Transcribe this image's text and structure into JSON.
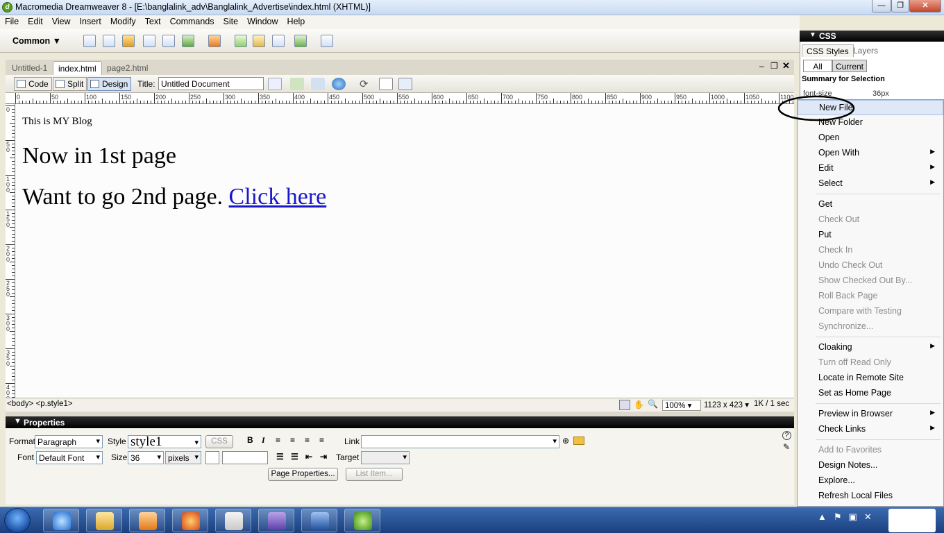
{
  "window": {
    "title": "Macromedia Dreamweaver 8 - [E:\\banglalink_adv\\Banglalink_Advertise\\index.html (XHTML)]",
    "minimize": "—",
    "maximize": "❐",
    "close": "✕"
  },
  "menu": [
    "File",
    "Edit",
    "View",
    "Insert",
    "Modify",
    "Text",
    "Commands",
    "Site",
    "Window",
    "Help"
  ],
  "insert_bar": {
    "category": "Common"
  },
  "doc_tabs": [
    "Untitled-1",
    "index.html",
    "page2.html"
  ],
  "doc_toolbar": {
    "code": "Code",
    "split": "Split",
    "design": "Design",
    "title_label": "Title:",
    "title_value": "Untitled Document"
  },
  "ruler": {
    "h_marks": [
      "0",
      "50",
      "100",
      "150",
      "200",
      "250",
      "300",
      "350",
      "400",
      "450",
      "500",
      "550",
      "600",
      "650",
      "700",
      "750",
      "800",
      "850",
      "900",
      "950",
      "1000",
      "1050",
      "1100"
    ],
    "v_marks": [
      "0",
      "50",
      "100",
      "150",
      "200",
      "250",
      "300",
      "350",
      "400"
    ]
  },
  "design_view": {
    "line1": "This is MY Blog",
    "line2": "Now in 1st page",
    "line3": "Want to go 2nd page.",
    "link": "Click here"
  },
  "status_bar": {
    "tags": "<body> <p.style1>",
    "zoom": "100%",
    "window_size": "1123 x 423",
    "download": "1K / 1 sec"
  },
  "properties": {
    "header": "Properties",
    "format_label": "Format",
    "format_value": "Paragraph",
    "style_label": "Style",
    "style_value": "style1",
    "css_button": "CSS",
    "link_label": "Link",
    "font_label": "Font",
    "font_value": "Default Font",
    "size_label": "Size",
    "size_value": "36",
    "unit_value": "pixels",
    "target_label": "Target",
    "page_properties": "Page Properties...",
    "list_item": "List Item...",
    "bold": "B",
    "italic": "I"
  },
  "css_panel": {
    "header": "CSS",
    "tabs": [
      "CSS Styles",
      "Layers"
    ],
    "modes": [
      "All",
      "Current"
    ],
    "summary": "Summary for Selection",
    "prop_name": "font-size",
    "prop_value": "36px"
  },
  "context_menu": [
    {
      "label": "New File",
      "enabled": true,
      "submenu": false,
      "highlight": true
    },
    {
      "label": "New Folder",
      "enabled": true,
      "submenu": false
    },
    {
      "label": "Open",
      "enabled": true,
      "submenu": false
    },
    {
      "label": "Open With",
      "enabled": true,
      "submenu": true
    },
    {
      "label": "Edit",
      "enabled": true,
      "submenu": true
    },
    {
      "label": "Select",
      "enabled": true,
      "submenu": true,
      "sep_after": true
    },
    {
      "label": "Get",
      "enabled": true,
      "submenu": false
    },
    {
      "label": "Check Out",
      "enabled": false,
      "submenu": false
    },
    {
      "label": "Put",
      "enabled": true,
      "submenu": false
    },
    {
      "label": "Check In",
      "enabled": false,
      "submenu": false
    },
    {
      "label": "Undo Check Out",
      "enabled": false,
      "submenu": false
    },
    {
      "label": "Show Checked Out By...",
      "enabled": false,
      "submenu": false
    },
    {
      "label": "Roll Back Page",
      "enabled": false,
      "submenu": false
    },
    {
      "label": "Compare with Testing",
      "enabled": false,
      "submenu": false
    },
    {
      "label": "Synchronize...",
      "enabled": false,
      "submenu": false,
      "sep_after": true
    },
    {
      "label": "Cloaking",
      "enabled": true,
      "submenu": true
    },
    {
      "label": "Turn off Read Only",
      "enabled": false,
      "submenu": false
    },
    {
      "label": "Locate in Remote Site",
      "enabled": true,
      "submenu": false
    },
    {
      "label": "Set as Home Page",
      "enabled": true,
      "submenu": false,
      "sep_after": true
    },
    {
      "label": "Preview in Browser",
      "enabled": true,
      "submenu": true
    },
    {
      "label": "Check Links",
      "enabled": true,
      "submenu": true,
      "sep_after": true
    },
    {
      "label": "Add to Favorites",
      "enabled": false,
      "submenu": false
    },
    {
      "label": "Design Notes...",
      "enabled": true,
      "submenu": false
    },
    {
      "label": "Explore...",
      "enabled": true,
      "submenu": false
    },
    {
      "label": "Refresh Local Files",
      "enabled": true,
      "submenu": false
    }
  ],
  "colors": {
    "link": "#1a16c9",
    "disabled": "#8d8d8d",
    "taskbar": "#1a3f7e"
  },
  "taskbar_icons": [
    "internet-explorer-icon",
    "file-explorer-icon",
    "media-player-icon",
    "firefox-icon",
    "paint-icon",
    "visual-studio-icon",
    "word-icon",
    "dreamweaver-icon"
  ]
}
